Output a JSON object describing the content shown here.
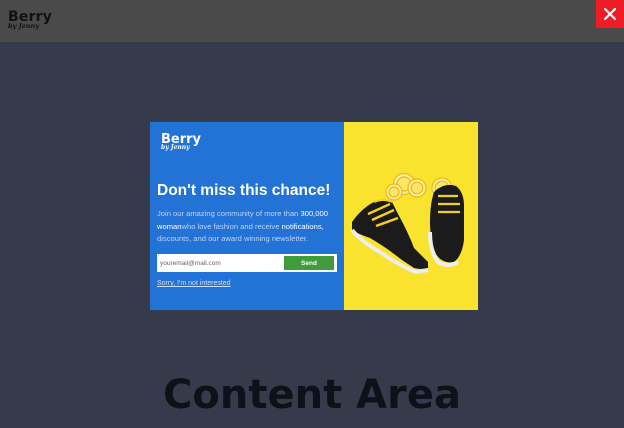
{
  "header": {
    "brand_name": "Berry",
    "brand_tagline": "by Jenny",
    "close_icon": "close-icon"
  },
  "modal": {
    "logo_name": "Berry",
    "logo_tagline": "by Jenny",
    "heading": "Don't miss this chance!",
    "description_1": "Join our amazing community of more than ",
    "description_count": "300,000",
    "description_2": "woman",
    "description_3": "who love fashion and receive ",
    "description_4": "notifications,",
    "description_5": "discounts, and our award winning newsletter.",
    "email_placeholder": "youremail@mail.com",
    "send_label": "Send",
    "decline_label": "Sorry, I'm not interested",
    "image_name": "sneakers-lemons-image"
  },
  "main": {
    "content_label": "Content Area"
  },
  "colors": {
    "header_bg": "#4a4a4a",
    "overlay_bg": "#353b4b",
    "modal_left": "#2372d6",
    "modal_right": "#f9e32f",
    "send_btn": "#3f9b3c",
    "close_btn": "#ee1c25"
  }
}
